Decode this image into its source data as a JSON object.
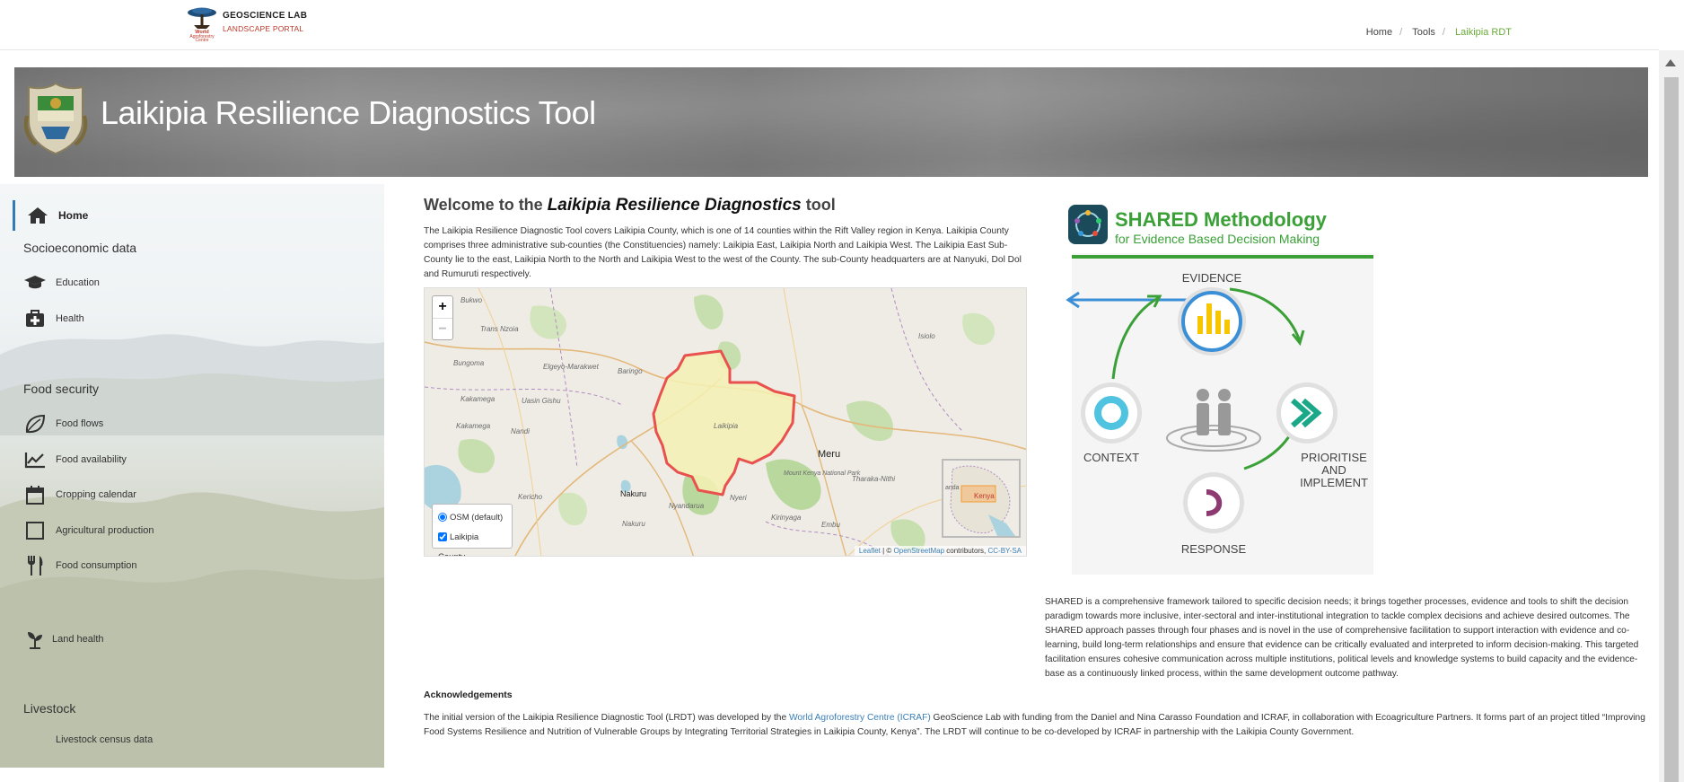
{
  "header": {
    "logo_line1": "GEOSCIENCE LAB",
    "logo_line2": "LANDSCAPE PORTAL",
    "logo_subtext": "World Agroforestry Centre",
    "breadcrumbs": [
      "Home",
      "Tools",
      "Laikipia RDT"
    ],
    "accent_color": "#6aaa3a"
  },
  "banner": {
    "title": "Laikipia Resilience Diagnostics Tool"
  },
  "sidebar": {
    "home_label": "Home",
    "sections": [
      {
        "title": "Socioeconomic data",
        "items": [
          {
            "label": "Education",
            "icon": "graduation-cap-icon"
          },
          {
            "label": "Health",
            "icon": "medical-kit-icon"
          }
        ]
      },
      {
        "title": "Food security",
        "items": [
          {
            "label": "Food flows",
            "icon": "leaf-icon"
          },
          {
            "label": "Food availability",
            "icon": "line-chart-icon"
          },
          {
            "label": "Cropping calendar",
            "icon": "calendar-icon"
          },
          {
            "label": "Agricultural production",
            "icon": "square-icon"
          },
          {
            "label": "Food consumption",
            "icon": "cutlery-icon"
          }
        ]
      },
      {
        "title": "",
        "items": [
          {
            "label": "Land health",
            "icon": "sprout-icon"
          }
        ]
      },
      {
        "title": "Livestock",
        "items": [
          {
            "label": "Livestock census data",
            "icon": ""
          }
        ]
      }
    ]
  },
  "main": {
    "welcome_prefix": "Welcome to the ",
    "welcome_emph": "Laikipia Resilience Diagnostics",
    "welcome_suffix": " tool",
    "intro": "The Laikipia Resilience Diagnostic Tool covers Laikipia County, which is one of 14 counties within the Rift Valley region in Kenya. Laikipia County comprises three administrative sub-counties (the Constituencies) namely: Laikipia East, Laikipia North and Laikipia West. The Laikipia East Sub- County lie to the east, Laikipia North to the North and Laikipia West to the west of the County. The sub-County headquarters are at Nanyuki, Dol Dol and Rumuruti respectively."
  },
  "map": {
    "zoom_in": "+",
    "zoom_out": "−",
    "layer_osm": "OSM (default)",
    "layer_county": "Laikipia County",
    "attrib_leaflet": "Leaflet",
    "attrib_mid": " | © ",
    "attrib_osm": "OpenStreetMap",
    "attrib_contrib": " contributors, ",
    "attrib_license": "CC-BY-SA",
    "places": [
      "Bukwo",
      "Trans Nzoia",
      "Elgeyo-Marakwet",
      "Baringo",
      "Bungoma",
      "Uasin Gishu",
      "Kakamega",
      "Kakamega",
      "Nandi",
      "Laikipia",
      "Meru",
      "Isiolo",
      "Kericho",
      "Nakuru",
      "Nakuru",
      "Nyandarua",
      "Nyeri",
      "Kirinyaga",
      "Embu",
      "Tharaka-Nithi",
      "Mount Kenya National Park",
      "Kenya",
      "anda"
    ],
    "county_fill": "#f4f1b4",
    "county_stroke": "#e8514e"
  },
  "shared": {
    "title": "SHARED Methodology",
    "subtitle": "for Evidence Based Decision Making",
    "evidence": "EVIDENCE",
    "context": "CONTEXT",
    "prioritise": "PRIORITISE",
    "and": "AND",
    "implement": "IMPLEMENT",
    "response": "RESPONSE",
    "description": "SHARED is a comprehensive framework tailored to specific decision needs; it brings together processes, evidence and tools to shift the decision paradigm towards more inclusive, inter-sectoral and inter-institutional integration to tackle complex decisions and achieve desired outcomes. The SHARED approach passes through four phases and is novel in the use of comprehensive facilitation to support interaction with evidence and co-learning, build long-term relationships and ensure that evidence can be critically evaluated and interpreted to inform decision-making. This targeted facilitation ensures cohesive communication across multiple institutions, political levels and knowledge systems to build capacity and the evidence-base as a continuously linked process, within the same development outcome pathway.",
    "green": "#3aa037",
    "blue": "#3b8fd6"
  },
  "ack": {
    "title": "Acknowledgements",
    "text_before": "The initial version of the Laikipia Resilience Diagnostic Tool (LRDT) was developed by the ",
    "link": "World Agroforestry Centre (ICRAF)",
    "text_after": " GeoScience Lab with funding from the Daniel and Nina Carasso Foundation and ICRAF, in collaboration with Ecoagriculture Partners. It forms part of an project titled “Improving Food Systems Resilience and Nutrition of Vulnerable Groups by Integrating Territorial Strategies in Laikipia County, Kenya”. The LRDT will continue to be co-developed by ICRAF in partnership with the Laikipia County Government."
  }
}
